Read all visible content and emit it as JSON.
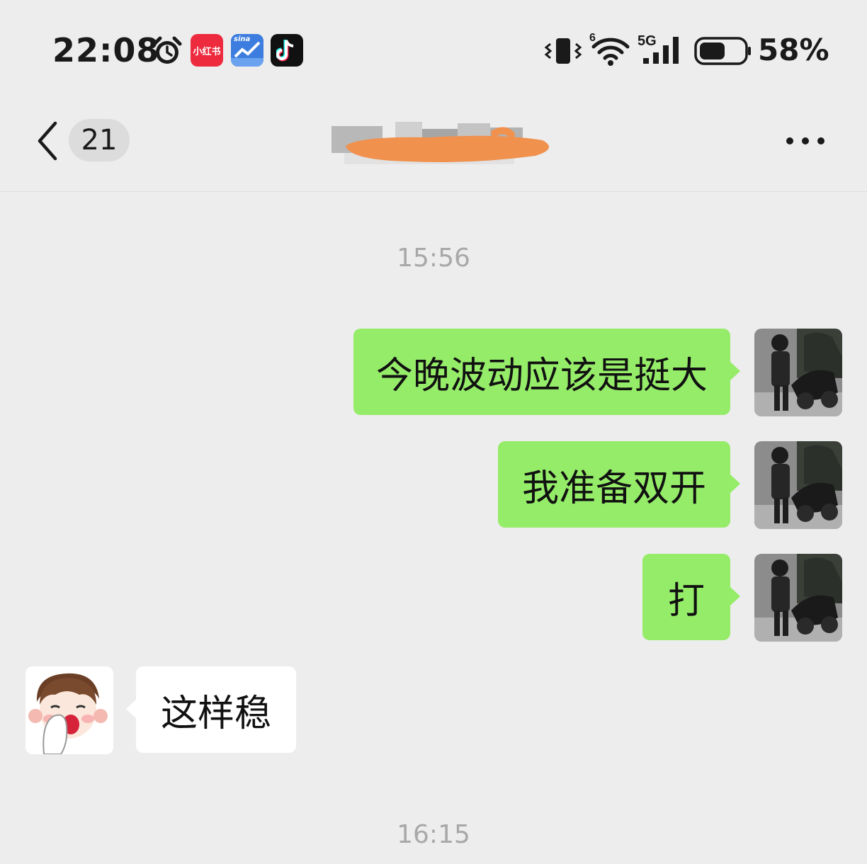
{
  "status_bar": {
    "time": "22:08",
    "app_icons": {
      "xiaohongshu": "小红书",
      "sina": "sina"
    },
    "wifi_badge": "6",
    "network": "5G",
    "battery_percent": "58%",
    "battery_level": 0.58
  },
  "nav": {
    "unread_count": "21",
    "title_redacted": true
  },
  "messages": [
    {
      "type": "timestamp",
      "text": "15:56"
    },
    {
      "type": "outgoing",
      "text": "今晚波动应该是挺大"
    },
    {
      "type": "outgoing",
      "text": "我准备双开"
    },
    {
      "type": "outgoing",
      "text": "打"
    },
    {
      "type": "incoming",
      "text": "这样稳"
    },
    {
      "type": "timestamp",
      "text": "16:15"
    }
  ],
  "colors": {
    "background": "#ededed",
    "outgoing_bubble": "#95ec69",
    "incoming_bubble": "#ffffff",
    "redaction": "#f0914e"
  }
}
